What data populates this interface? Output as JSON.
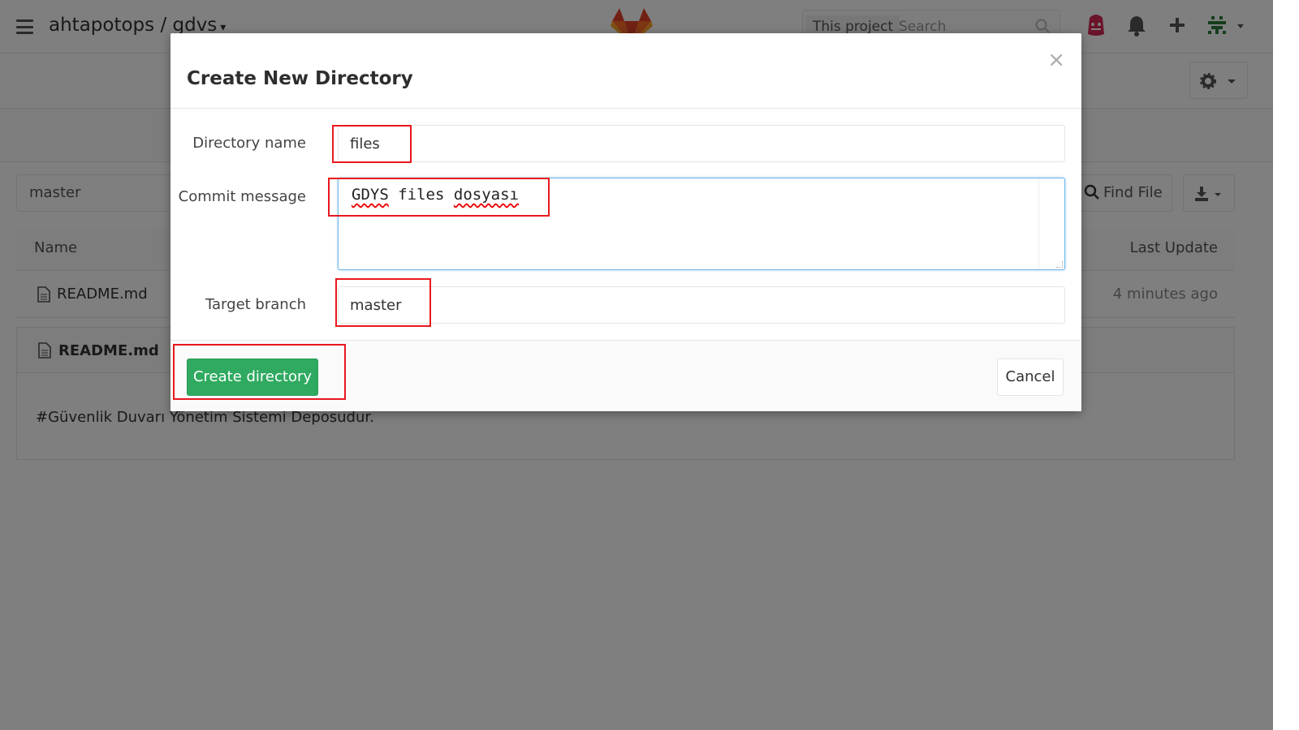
{
  "header": {
    "project_path": "ahtapotops / gdvs",
    "search_scope": "This project",
    "search_placeholder": "Search"
  },
  "repo": {
    "branch": "master",
    "find_file_label": "Find File",
    "table_headers": {
      "name": "Name",
      "last_update": "Last Update"
    },
    "files": [
      {
        "name": "README.md",
        "last_update": "4 minutes ago"
      }
    ],
    "readme": {
      "title": "README.md",
      "content": "#Güvenlik Duvarı Yönetim Sistemi Deposudur."
    }
  },
  "modal": {
    "title": "Create New Directory",
    "close_glyph": "×",
    "fields": {
      "directory_name_label": "Directory name",
      "directory_name_value": "files",
      "commit_message_label": "Commit message",
      "commit_message_word1": "GDYS",
      "commit_message_word2": "files",
      "commit_message_word3": "dosyası",
      "target_branch_label": "Target branch",
      "target_branch_value": "master"
    },
    "create_button": "Create directory",
    "cancel_button": "Cancel"
  },
  "colors": {
    "primary_green": "#2faa60",
    "highlight_red": "#e8181f",
    "focus_blue": "#6fb7e6",
    "gitlab_orange": "#e24329"
  },
  "icons": [
    "hamburger-icon",
    "gitlab-logo",
    "search-icon",
    "issues-icon",
    "bell-icon",
    "plus-icon",
    "avatar",
    "gear-icon",
    "download-icon",
    "file-icon",
    "close-icon"
  ]
}
